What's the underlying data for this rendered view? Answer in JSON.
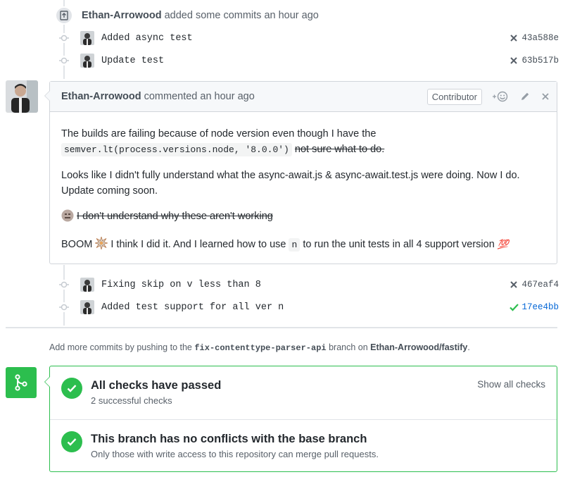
{
  "push_event": {
    "author": "Ethan-Arrowood",
    "action": "added some commits an hour ago"
  },
  "commits_top": [
    {
      "message": "Added async test",
      "sha": "43a588e",
      "status": "failure"
    },
    {
      "message": "Update test",
      "sha": "63b517b",
      "status": "failure"
    }
  ],
  "comment": {
    "author": "Ethan-Arrowood",
    "action": "commented an hour ago",
    "badge": "Contributor",
    "reaction_icon": "smiley-icon",
    "edit_icon": "pencil-icon",
    "delete_icon": "close-icon",
    "p1_text": "The builds are failing because of node version even though I have the",
    "p1_code": "semver.lt(process.versions.node, '8.0.0')",
    "p1_strike": "not sure what to do.",
    "p2": "Looks like I didn't fully understand what the async-await.js & async-await.test.js were doing. Now I do. Update coming soon.",
    "p3_emoji": "confused-face-emoji",
    "p3_strike": "I don't understand why these aren't working",
    "p4_pre": "BOOM",
    "p4_emoji": "collision-emoji",
    "p4_mid": "I think I did it. And I learned how to use",
    "p4_code": "n",
    "p4_post": "to run the unit tests in all 4 support version",
    "p4_end_emoji": "💯"
  },
  "commits_bottom": [
    {
      "message": "Fixing skip on v less than 8",
      "sha": "467eaf4",
      "status": "failure"
    },
    {
      "message": "Added test support for all ver n",
      "sha": "17ee4bb",
      "status": "success"
    }
  ],
  "push_note": {
    "pre": "Add more commits by pushing to the",
    "branch": "fix-contenttype-parser-api",
    "mid": "branch on",
    "repo": "Ethan-Arrowood/fastify",
    "end": "."
  },
  "merge": {
    "checks_title": "All checks have passed",
    "checks_sub": "2 successful checks",
    "show_all": "Show all checks",
    "conflict_title": "This branch has no conflicts with the base branch",
    "conflict_sub": "Only those with write access to this repository can merge pull requests."
  },
  "colors": {
    "success": "#2cbe4e",
    "failure": "#586069",
    "border": "#d1d5da"
  }
}
